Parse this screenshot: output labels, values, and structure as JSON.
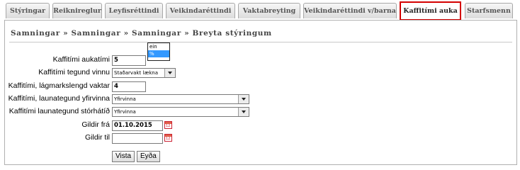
{
  "tabs": [
    {
      "label": "Stýringar",
      "active": false
    },
    {
      "label": "Reiknireglur",
      "active": false
    },
    {
      "label": "Leyfisréttindi",
      "active": false
    },
    {
      "label": "Veikindaréttindi",
      "active": false
    },
    {
      "label": "Vaktabreyting",
      "active": false
    },
    {
      "label": "Veikindaréttindi v/barna",
      "active": false
    },
    {
      "label": "Kaffitími auka",
      "active": true
    },
    {
      "label": "Starfsmenn",
      "active": false
    }
  ],
  "breadcrumb": "Samningar » Samningar » Samningar » Breyta stýringum",
  "form": {
    "aukatimi": {
      "label": "Kaffitími aukatími",
      "value": "5"
    },
    "tegund": {
      "label": "Kaffitími tegund vinnu",
      "value": "Staðarvakt lækna"
    },
    "lagmarkslengd": {
      "label": "Kaffitími, lágmarkslengd vaktar",
      "value": "4"
    },
    "launategund_yfirvinna": {
      "label": "Kaffitími, launategund yfirvinna",
      "value": "Yfirvinna"
    },
    "launategund_storhatid": {
      "label": "Kaffitími launategund stórhátíð",
      "value": "Yfirvinna"
    },
    "gildir_fra": {
      "label": "Gildir frá",
      "value": "01.10.2015"
    },
    "gildir_til": {
      "label": "Gildir til",
      "value": ""
    }
  },
  "dropdown_options": [
    {
      "label": "ein",
      "selected": false
    },
    {
      "label": "%",
      "selected": true
    }
  ],
  "buttons": {
    "vista": "Vista",
    "eyda": "Eyða"
  },
  "accent_color": "#d40000"
}
